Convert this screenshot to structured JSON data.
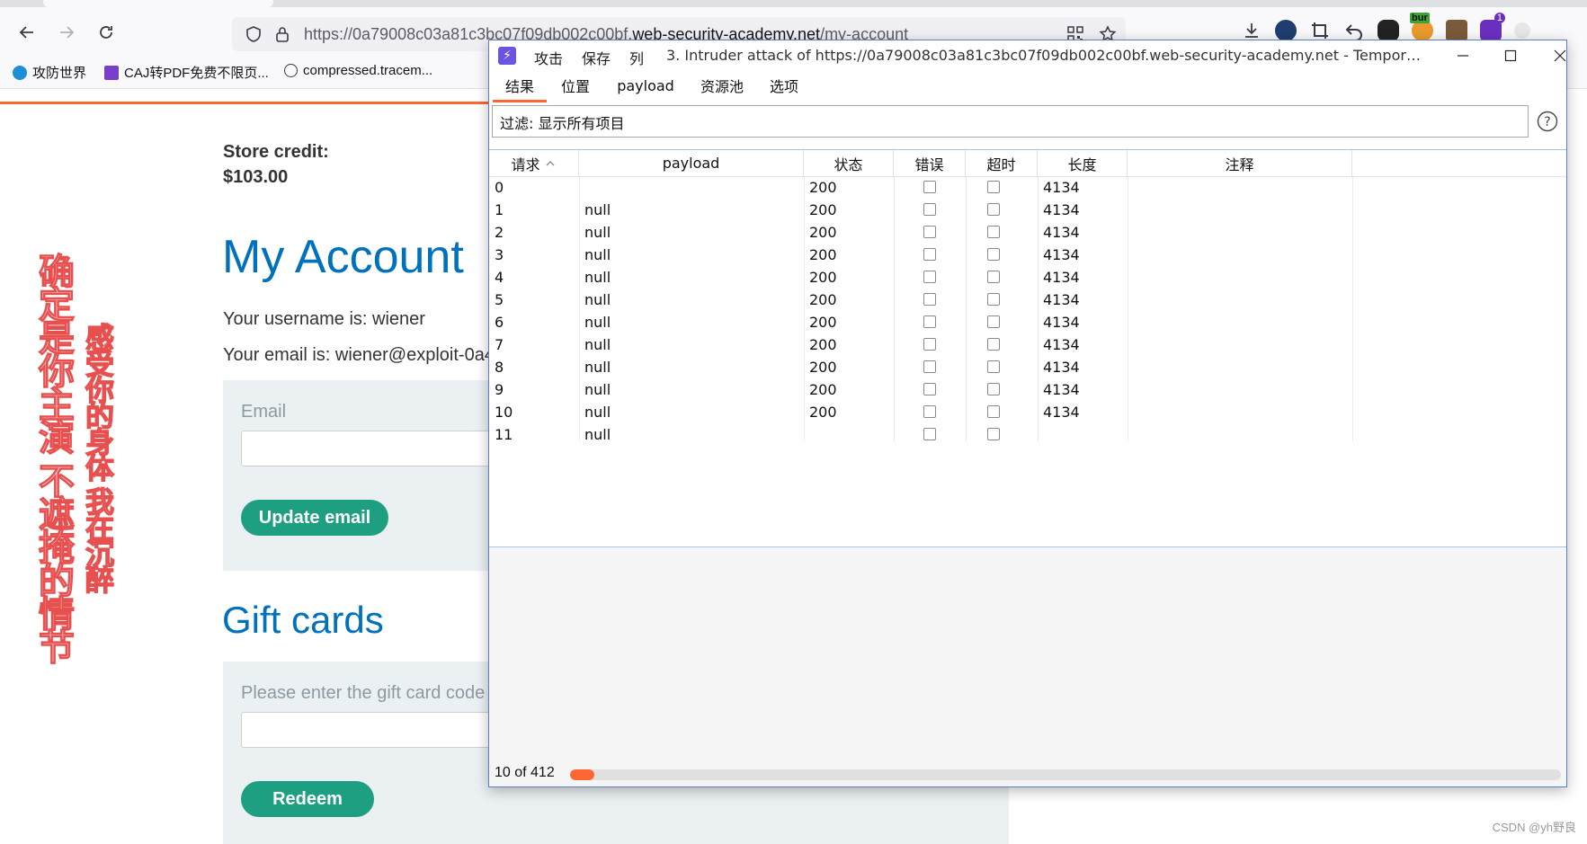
{
  "browser": {
    "url_prefix": "https://0a79008c03a81c3bc07f09db002c00bf.",
    "url_domain": "web-security-academy.net",
    "url_path": "/my-account",
    "bookmarks": [
      "攻防世界",
      "CAJ转PDF免费不限页...",
      "compressed.tracem..."
    ],
    "extensions": [
      "download-icon",
      "avatar-icon",
      "crop-icon",
      "undo-icon",
      "ghost-icon",
      "burp-extension-icon",
      "user-photo-icon",
      "purple-extension-icon",
      "more-icon"
    ],
    "badge_burp": "bur",
    "badge_count": "1"
  },
  "page": {
    "credit_label": "Store credit:",
    "credit_value": "$103.00",
    "title": "My Account",
    "username_line": "Your username is: wiener",
    "email_line": "Your email is: wiener@exploit-0a4",
    "email_label": "Email",
    "update_button": "Update email",
    "gift_title": "Gift cards",
    "gift_label": "Please enter the gift card code",
    "redeem_button": "Redeem",
    "side_text_1": "确定是你主演 不遮掩的情节",
    "side_text_2": "感受你的身体 我在沉醉",
    "watermark": "CSDN @yh野良"
  },
  "burp": {
    "menu": [
      "攻击",
      "保存",
      "列"
    ],
    "window_title": "3. Intruder attack of https://0a79008c03a81c3bc07f09db002c00bf.web-security-academy.net - Temporary att...",
    "tabs": [
      "结果",
      "位置",
      "payload",
      "资源池",
      "选项"
    ],
    "filter": "过滤: 显示所有项目",
    "columns": [
      "请求",
      "payload",
      "状态",
      "错误",
      "超时",
      "长度",
      "注释"
    ],
    "rows": [
      {
        "req": "0",
        "payload": "",
        "status": "200",
        "length": "4134"
      },
      {
        "req": "1",
        "payload": "null",
        "status": "200",
        "length": "4134"
      },
      {
        "req": "2",
        "payload": "null",
        "status": "200",
        "length": "4134"
      },
      {
        "req": "3",
        "payload": "null",
        "status": "200",
        "length": "4134"
      },
      {
        "req": "4",
        "payload": "null",
        "status": "200",
        "length": "4134"
      },
      {
        "req": "5",
        "payload": "null",
        "status": "200",
        "length": "4134"
      },
      {
        "req": "6",
        "payload": "null",
        "status": "200",
        "length": "4134"
      },
      {
        "req": "7",
        "payload": "null",
        "status": "200",
        "length": "4134"
      },
      {
        "req": "8",
        "payload": "null",
        "status": "200",
        "length": "4134"
      },
      {
        "req": "9",
        "payload": "null",
        "status": "200",
        "length": "4134"
      },
      {
        "req": "10",
        "payload": "null",
        "status": "200",
        "length": "4134"
      },
      {
        "req": "11",
        "payload": "null",
        "status": "",
        "length": ""
      }
    ],
    "progress_text": "10 of 412",
    "progress_fraction": 0.0243,
    "colors": {
      "accent": "#ff6633",
      "logo": "#6c53e0",
      "border": "#5a7fc5"
    }
  }
}
